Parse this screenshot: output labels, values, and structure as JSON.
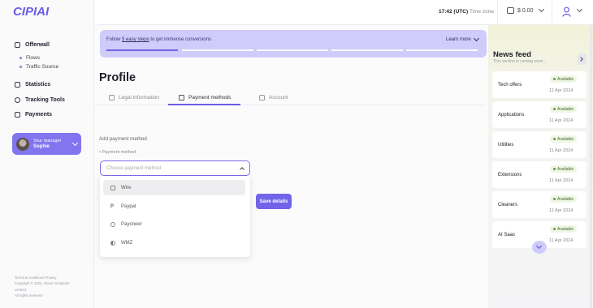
{
  "brand": {
    "logo_text": "CIPIAI"
  },
  "sidebar": {
    "items": [
      {
        "label": "Offerwall",
        "icon": "grid-icon"
      },
      {
        "label": "Statistics",
        "icon": "chart-icon"
      },
      {
        "label": "Tracking Tools",
        "icon": "settings-icon"
      },
      {
        "label": "Payments",
        "icon": "card-icon"
      }
    ],
    "sub_items": [
      "Flows",
      "Traffic Source"
    ],
    "manager": {
      "caption": "Your manager",
      "name": "Sophie"
    },
    "footer": [
      "Terms & conditions   Privacy",
      "Copyright © 2024, Stover Solutions",
      "Limited",
      "All rights reserved"
    ]
  },
  "topbar": {
    "time": "17:42 (UTC)",
    "timezone_label": "Time zone",
    "balance": "$ 0.00"
  },
  "banner": {
    "prefix": "Follow ",
    "link": "5 easy steps",
    "suffix": " to get immense conversions",
    "learn_more": "Learn more",
    "progress": [
      1,
      0,
      0,
      0,
      0
    ]
  },
  "profile": {
    "title": "Profile",
    "tabs": [
      {
        "label": "Legal information",
        "active": false
      },
      {
        "label": "Payment methods",
        "active": true
      },
      {
        "label": "Account",
        "active": false
      }
    ],
    "section_title": "Add payment method",
    "field_label": "• Payment method",
    "select_placeholder": "Choose payment method",
    "options": [
      "Wire",
      "Paypal",
      "Payoneer",
      "WMZ"
    ],
    "selected_option": "Wire",
    "save_label": "Save details"
  },
  "news": {
    "title": "News feed",
    "subtitle": "This section is coming soon...",
    "cards": [
      {
        "name": "Tech offers",
        "status": "Available",
        "date": "11 Apr 2024"
      },
      {
        "name": "Applications",
        "status": "Available",
        "date": "11 Apr 2024"
      },
      {
        "name": "Utilities",
        "status": "Available",
        "date": "11 Apr 2024"
      },
      {
        "name": "Extensions",
        "status": "Available",
        "date": "11 Apr 2024"
      },
      {
        "name": "Cleaners",
        "status": "Available",
        "date": "11 Apr 2024"
      },
      {
        "name": "AI Saas",
        "status": "Available",
        "date": "11 Apr 2024"
      }
    ]
  },
  "colors": {
    "accent": "#7264ea",
    "banner": "#cfcbfa",
    "manager_card": "#8175f0"
  }
}
